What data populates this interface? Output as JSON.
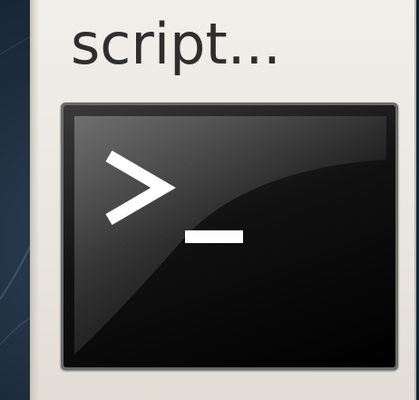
{
  "launcher": {
    "label": "script...",
    "icon": "terminal-icon",
    "prompt_icon": "shell-prompt-glyph"
  },
  "colors": {
    "desktop_background": "#1c2c3b",
    "tile_background": "#ece9e3",
    "label_text": "#2e2e2e",
    "terminal_background": "#000000",
    "prompt_foreground": "#ffffff"
  }
}
